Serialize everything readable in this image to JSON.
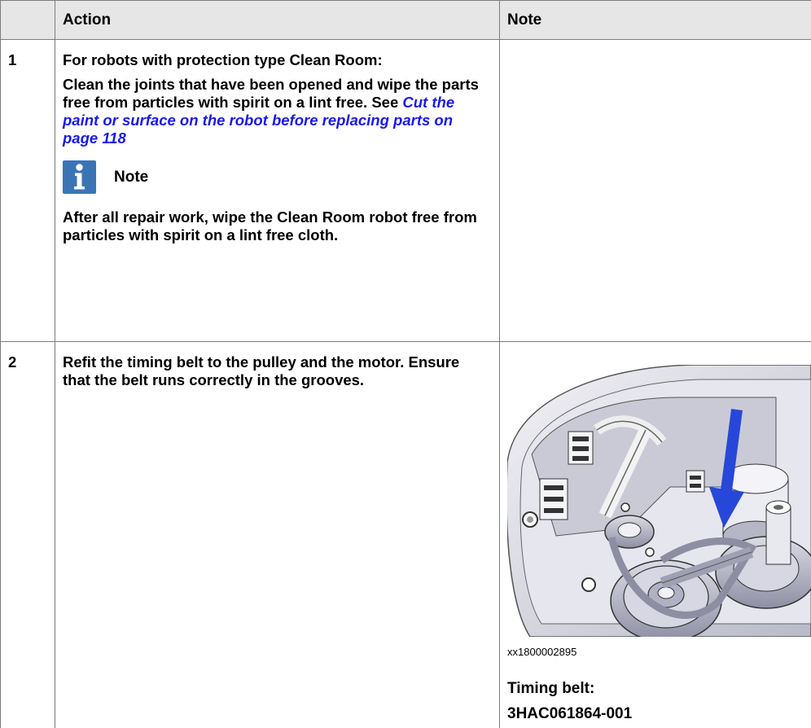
{
  "table": {
    "header": {
      "step": "",
      "action": "Action",
      "note": "Note"
    },
    "rows": [
      {
        "step": "1",
        "action": {
          "intro": "For robots with protection type Clean Room:",
          "text": "Clean the joints that have been opened and wipe the parts free from particles with spirit on a lint free. See ",
          "link": "Cut the paint or surface on the robot before replacing parts on page 118",
          "note_label": "Note",
          "note_text": "After all repair work, wipe the Clean Room robot free from particles with spirit on a lint free cloth."
        },
        "note": ""
      },
      {
        "step": "2",
        "action": {
          "text": "Refit the timing belt to the pulley and the motor. Ensure that the belt runs correctly in the grooves."
        },
        "note": {
          "figure_id": "xx1800002895",
          "caption_line1": "Timing belt:",
          "caption_line2": "3HAC061864-001"
        }
      }
    ]
  },
  "colors": {
    "header_bg": "#e6e6e6",
    "link": "#1a1ae6",
    "note_icon": "#3b74b5",
    "arrow": "#2747d9"
  },
  "icons": {
    "note": "info-icon"
  }
}
